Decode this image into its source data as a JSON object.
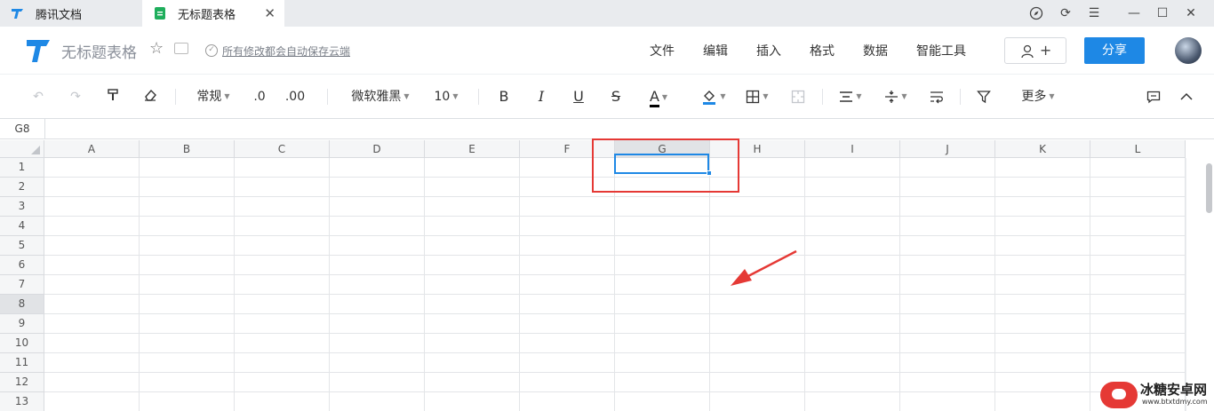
{
  "tabs": [
    {
      "label": "腾讯文档",
      "active": false
    },
    {
      "label": "无标题表格",
      "active": true
    }
  ],
  "header": {
    "doc_title": "无标题表格",
    "save_status": "所有修改都会自动保存云端",
    "menus": [
      "文件",
      "编辑",
      "插入",
      "格式",
      "数据",
      "智能工具"
    ],
    "share_label": "分享",
    "collab_label": "+"
  },
  "toolbar": {
    "number_format": "常规",
    "decrease_decimal": ".0",
    "increase_decimal": ".00",
    "font_family": "微软雅黑",
    "font_size": "10",
    "bold": "B",
    "italic": "I",
    "underline": "U",
    "strike": "S",
    "font_color": "A",
    "more_label": "更多"
  },
  "formula_bar": {
    "cell_ref": "G8"
  },
  "grid": {
    "columns": [
      "A",
      "B",
      "C",
      "D",
      "E",
      "F",
      "G",
      "H",
      "I",
      "J",
      "K",
      "L"
    ],
    "rows": [
      "1",
      "2",
      "3",
      "4",
      "5",
      "6",
      "7",
      "8",
      "9",
      "10",
      "11",
      "12",
      "13"
    ],
    "selected_column": "G",
    "selected_row": "8"
  },
  "watermark": {
    "title": "冰糖安卓网",
    "url": "www.btxtdmy.com"
  },
  "colors": {
    "accent": "#1e88e5",
    "annotation": "#e53935",
    "logo_blue": "#1e88e5",
    "sheet_green": "#1fae5c"
  }
}
